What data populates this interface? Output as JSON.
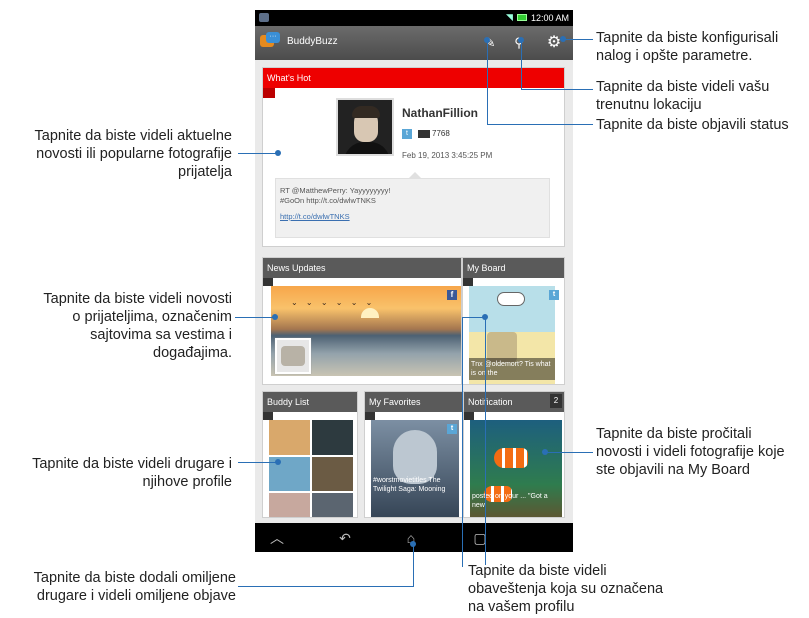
{
  "statusbar": {
    "time": "12:00 AM"
  },
  "app": {
    "title": "BuddyBuzz",
    "icons": [
      "compose-icon",
      "location-pin-icon",
      "gear-icon"
    ]
  },
  "whats_hot": {
    "title": "What's Hot",
    "name": "NathanFillion",
    "twitter_badge": "t",
    "count": "7768",
    "date": "Feb 19, 2013 3:45:25 PM",
    "quote_line1": "RT @MatthewPerry: Yayyyyyyyy!",
    "quote_line2": "#GoOn http://t.co/dwlwTNKS",
    "quote_link": "http://t.co/dwlwTNKS"
  },
  "tiles": {
    "news": {
      "title": "News Updates",
      "badge": "f"
    },
    "board": {
      "title": "My Board",
      "badge": "t",
      "caption": "Tnx @oldemort?  Tis what is on the"
    },
    "buddy": {
      "title": "Buddy List"
    },
    "favorites": {
      "title": "My Favorites",
      "badge": "t",
      "caption": "#worstmovietitles The Twilight Saga: Mooning"
    },
    "notification": {
      "title": "Notification",
      "count": "2",
      "caption": "posted on your ... \"Got a new"
    }
  },
  "nav": {
    "home": "⌂",
    "back": "↶",
    "home2": "⌂",
    "recent": "▢"
  },
  "callouts": {
    "config": [
      "Tapnite da biste konfigurisali",
      "nalog i opšte parametre."
    ],
    "location": [
      "Tapnite da biste videli vašu",
      "trenutnu lokaciju"
    ],
    "status": [
      "Tapnite da biste objavili status"
    ],
    "hot": [
      "Tapnite da biste videli aktuelne",
      "novosti ili popularne fotografije",
      "prijatelja"
    ],
    "news": [
      "Tapnite da biste videli novosti",
      "o prijateljima, označenim",
      "sajtovima sa vestima i",
      "događajima."
    ],
    "buddies": [
      "Tapnite da biste videli drugare i",
      "njihove profile"
    ],
    "board": [
      "Tapnite da biste pročitali",
      "novosti i videli fotografije koje",
      "ste objavili na My Board"
    ],
    "favorites": [
      "Tapnite da biste dodali omiljene",
      "drugare i videli omiljene objave"
    ],
    "notification": [
      "Tapnite da biste videli",
      "obaveštenja koja su označena",
      "na vašem profilu"
    ]
  }
}
